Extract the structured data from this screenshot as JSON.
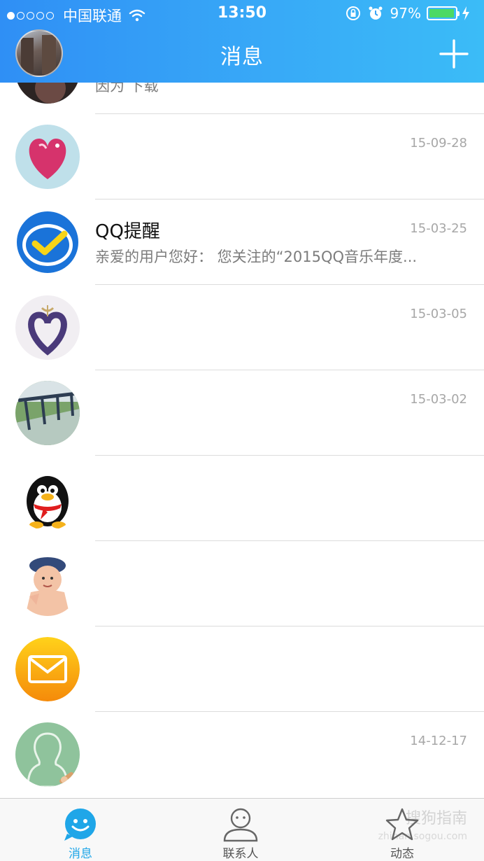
{
  "status_bar": {
    "carrier": "中国联通",
    "time": "13:50",
    "battery_percent": "97%",
    "battery_level": 0.97,
    "icons": [
      "signal-dots-icon",
      "wifi-icon",
      "rotation-lock-icon",
      "alarm-icon",
      "battery-icon",
      "charging-icon"
    ]
  },
  "nav": {
    "title": "消息",
    "avatar_icon": "user-avatar",
    "plus_icon": "plus-icon"
  },
  "conversations": [
    {
      "name": "",
      "time": "",
      "preview": "因为 下载",
      "avatar": "dark-avatar"
    },
    {
      "name": "",
      "time": "15-09-28",
      "preview": "",
      "avatar": "pink-heart-avatar"
    },
    {
      "name": "QQ提醒",
      "time": "15-03-25",
      "preview": "亲爱的用户您好： 您关注的“2015QQ音乐年度...",
      "avatar": "qq-reminder-check-avatar"
    },
    {
      "name": "",
      "time": "15-03-05",
      "preview": "",
      "avatar": "lavender-heart-avatar"
    },
    {
      "name": "",
      "time": "15-03-02",
      "preview": "",
      "avatar": "railing-photo-avatar"
    },
    {
      "name": "",
      "time": "",
      "preview": "",
      "avatar": "qq-penguin-avatar"
    },
    {
      "name": "",
      "time": "",
      "preview": "",
      "avatar": "child-photo-avatar"
    },
    {
      "name": "",
      "time": "",
      "preview": "",
      "avatar": "mail-icon-avatar"
    },
    {
      "name": "",
      "time": "14-12-17",
      "preview": "",
      "avatar": "default-silhouette-avatar"
    }
  ],
  "tabs": [
    {
      "label": "消息",
      "icon": "message-bubble-icon",
      "active": true
    },
    {
      "label": "联系人",
      "icon": "contact-person-icon",
      "active": false
    },
    {
      "label": "动态",
      "icon": "star-icon",
      "active": false
    }
  ],
  "watermark": {
    "text": "搜狗指南",
    "sub": "zhinan.sogou.com"
  },
  "colors": {
    "header_start": "#2f8ff5",
    "header_end": "#3bbcf7",
    "accent": "#1fa6e8",
    "battery": "#4cd964"
  }
}
